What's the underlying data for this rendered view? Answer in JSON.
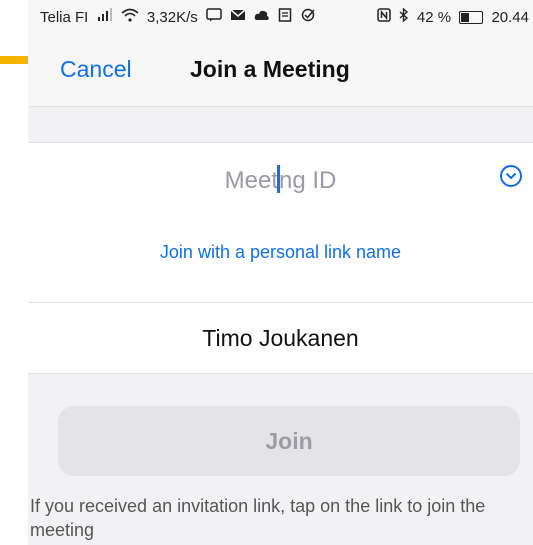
{
  "status_bar": {
    "carrier": "Telia FI",
    "signal_icon": "signal-bars-icon",
    "wifi_icon": "wifi-icon",
    "data_speed": "3,32K/s",
    "notification_icons": [
      "message-icon",
      "mail-icon",
      "cloud-icon",
      "document-icon",
      "check-circle-icon"
    ],
    "nfc_icon": "nfc-icon",
    "bluetooth_icon": "bluetooth-icon",
    "battery_percent": "42 %",
    "battery_level": 0.42,
    "time": "20.44"
  },
  "nav": {
    "cancel_label": "Cancel",
    "title": "Join a Meeting"
  },
  "meeting_id": {
    "placeholder_before_caret": "Meet",
    "placeholder_after_caret": "ng ID",
    "dropdown_icon": "chevron-down-circle-icon"
  },
  "personal_link_label": "Join with a personal link name",
  "display_name": "Timo Joukanen",
  "join_button_label": "Join",
  "info_text": "If you received an invitation link, tap on the link to join the meeting",
  "colors": {
    "accent_blue": "#0e71eb",
    "background": "#f2f2f4",
    "button_disabled": "#e4e4e8",
    "side_strip": "#f5b400"
  }
}
